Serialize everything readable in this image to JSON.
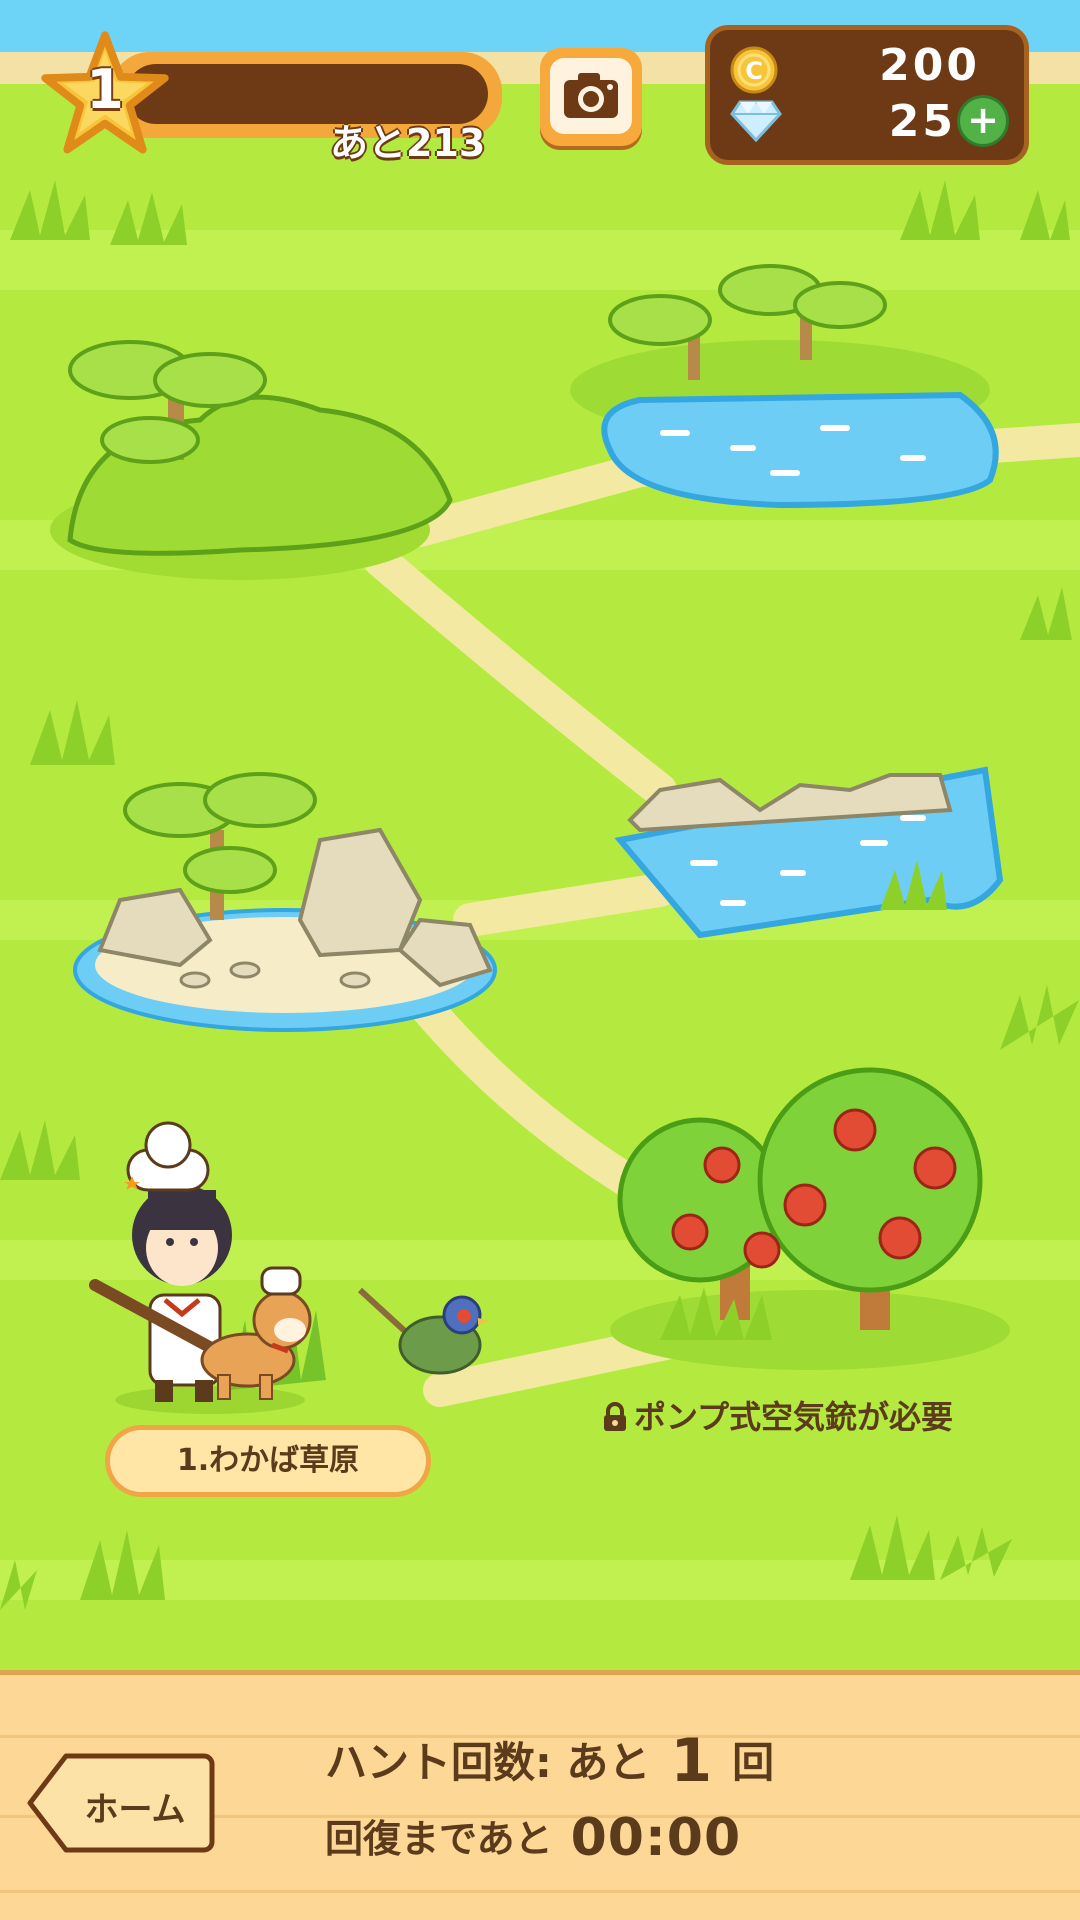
{
  "player": {
    "level": "1",
    "xp_remaining_label": "あと213",
    "xp_progress": 0.0
  },
  "currency": {
    "coins": "200",
    "gems": "25",
    "add_symbol": "+"
  },
  "icons": {
    "level": "star-icon",
    "camera": "camera-icon",
    "coin": "coin-icon",
    "gem": "diamond-icon",
    "add": "plus-icon",
    "lock": "lock-icon",
    "home": "home-button-arrow"
  },
  "map": {
    "current_area_label": "1.わかば草原",
    "locked_requirement": "ポンプ式空気銃が必要"
  },
  "footer": {
    "home_label": "ホーム",
    "hunt_prefix": "ハント回数: あと",
    "hunt_count": "1",
    "hunt_suffix": "回",
    "recover_prefix": "回復まであと",
    "recover_time": "00:00"
  },
  "colors": {
    "grass": "#b4ea3f",
    "path": "#f3e9a2",
    "water": "#5cc8f4",
    "panel_brown": "#6e3a16",
    "accent_orange": "#f7a93c"
  }
}
